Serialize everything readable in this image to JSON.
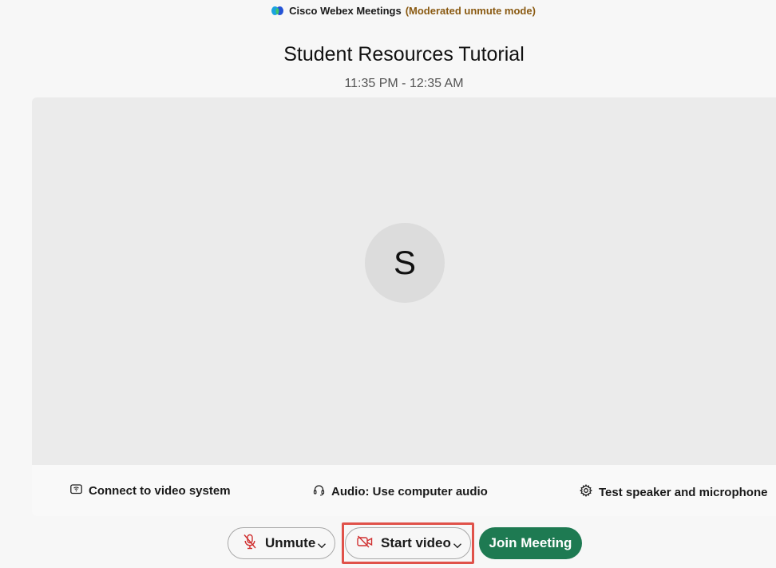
{
  "header": {
    "app_name": "Cisco Webex Meetings",
    "mode_label": "(Moderated unmute mode)"
  },
  "meeting": {
    "title": "Student Resources Tutorial",
    "time": "11:35 PM - 12:35 AM"
  },
  "preview": {
    "avatar_initial": "S"
  },
  "options": {
    "connect_video": "Connect to video system",
    "audio": "Audio: Use computer audio",
    "test": "Test speaker and microphone"
  },
  "controls": {
    "unmute_label": "Unmute",
    "video_label": "Start video",
    "join_label": "Join Meeting"
  },
  "colors": {
    "join_button": "#1e7a52",
    "highlight_outline": "#e0524a",
    "mode_text": "#8a5a12",
    "muted_icon": "#d03030"
  }
}
